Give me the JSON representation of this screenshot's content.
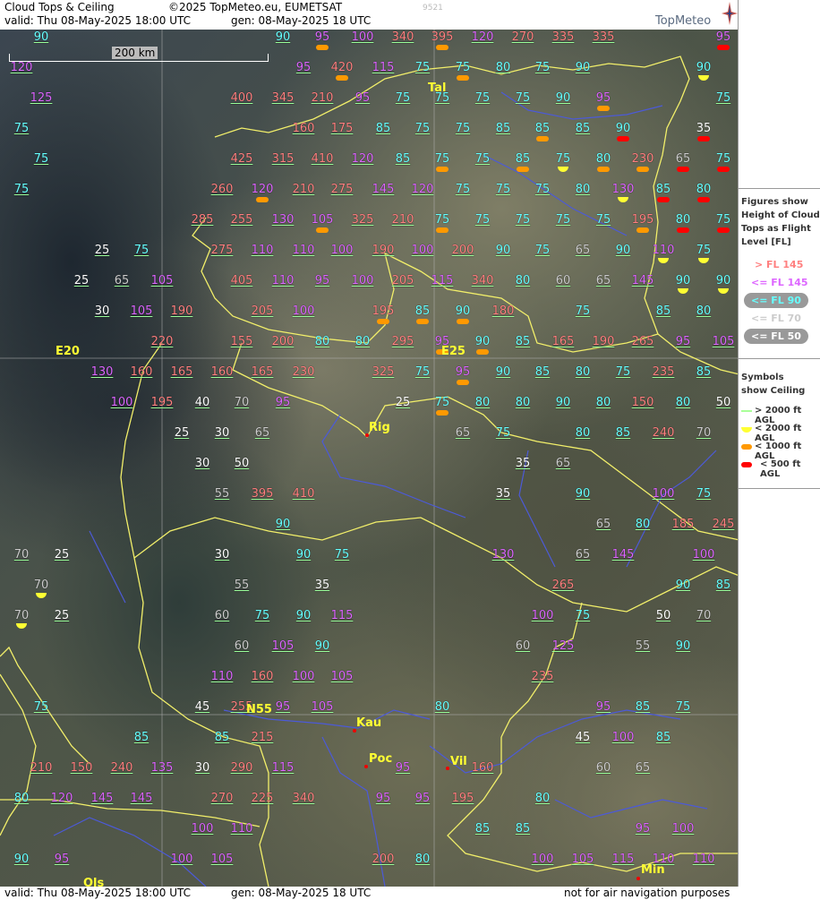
{
  "header": {
    "title": "Cloud Tops & Ceiling",
    "copyright": "©2025 TopMeteo.eu, EUMETSAT",
    "valid": "valid:  Thu  08-May-2025  18:00 UTC",
    "generated": "gen: 08-May-2025 18 UTC",
    "image_id": "9521",
    "brand": "TopMeteo"
  },
  "scale": {
    "label": "200 km"
  },
  "footer": {
    "valid": "valid:  Thu  08-May-2025  18:00 UTC",
    "generated": "gen: 08-May-2025 18 UTC",
    "disclaimer": "not for air navigation purposes"
  },
  "legend": {
    "title": "Figures show Height of Cloud Tops as Flight Level  [FL]",
    "items": [
      {
        "label": "> FL 145",
        "color": "#ff8080"
      },
      {
        "label": "<= FL 145",
        "color": "#dd66ff"
      },
      {
        "label": "<= FL 90",
        "color": "#66ffff"
      },
      {
        "label": "<= FL 70",
        "color": "#cccccc"
      },
      {
        "label": "<= FL 50",
        "color": "#ffffff"
      }
    ],
    "symbols_title": "Symbols show Ceiling",
    "symbols": [
      {
        "label": "> 2000 ft AGL",
        "color": "#aaff99"
      },
      {
        "label": "< 2000 ft AGL",
        "color": "#ffff33"
      },
      {
        "label": "< 1000 ft AGL",
        "color": "#ff9900"
      },
      {
        "label": "< 500 ft AGL",
        "color": "#ff0000"
      }
    ]
  },
  "grid_labels": {
    "e20": "E20",
    "e25": "E25",
    "n55": "N55"
  },
  "cities": [
    {
      "name": "Tal"
    },
    {
      "name": "Rig"
    },
    {
      "name": "Kau"
    },
    {
      "name": "Poc"
    },
    {
      "name": "Vil"
    },
    {
      "name": "Min"
    },
    {
      "name": "Ols"
    }
  ]
}
